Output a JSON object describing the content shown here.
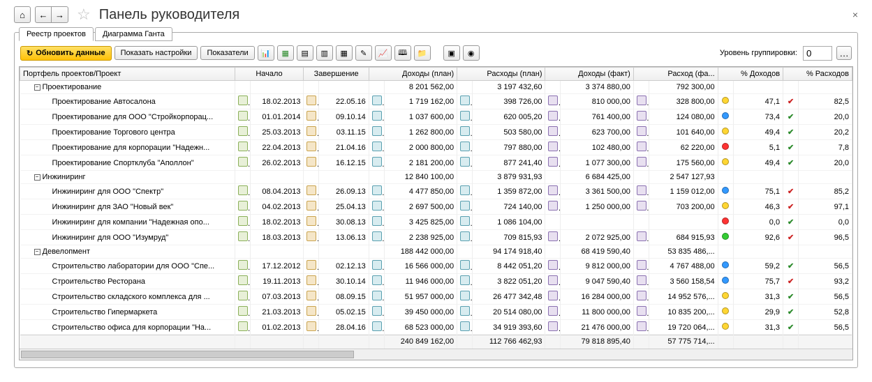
{
  "header": {
    "title": "Панель руководителя"
  },
  "tabs": [
    {
      "label": "Реестр проектов",
      "active": true
    },
    {
      "label": "Диаграмма Ганта",
      "active": false
    }
  ],
  "toolbar": {
    "refresh": "Обновить данные",
    "show_settings": "Показать настройки",
    "indicators": "Показатели",
    "grouping_label": "Уровень группировки:",
    "grouping_value": "0"
  },
  "columns": [
    "Портфель проектов/Проект",
    "Начало",
    "Завершение",
    "Доходы (план)",
    "Расходы (план)",
    "Доходы (факт)",
    "Расход (фа...",
    "% Доходов",
    "% Расходов"
  ],
  "groups": [
    {
      "name": "Проектирование",
      "sums": {
        "dp": "8 201 562,00",
        "rp": "3 197 432,60",
        "df": "3 374 880,00",
        "rf": "792 300,00"
      },
      "rows": [
        {
          "name": "Проектирование Автосалона",
          "start": "18.02.2013",
          "end": "22.05.16",
          "dp": "1 719 162,00",
          "rp": "398 726,00",
          "df": "810 000,00",
          "rf": "328 800,00",
          "pd": "47,1",
          "pr": "82,5",
          "d1": "y",
          "chk": "r"
        },
        {
          "name": "Проектирование для ООО \"Стройкорпорац...",
          "start": "01.01.2014",
          "end": "09.10.14",
          "dp": "1 037 600,00",
          "rp": "620 005,20",
          "df": "761 400,00",
          "rf": "124 080,00",
          "pd": "73,4",
          "pr": "20,0",
          "d1": "b",
          "chk": "g"
        },
        {
          "name": "Проектирование Торгового центра",
          "start": "25.03.2013",
          "end": "03.11.15",
          "dp": "1 262 800,00",
          "rp": "503 580,00",
          "df": "623 700,00",
          "rf": "101 640,00",
          "pd": "49,4",
          "pr": "20,2",
          "d1": "y",
          "chk": "g"
        },
        {
          "name": "Проектирование для корпорации \"Надежн...",
          "start": "22.04.2013",
          "end": "21.04.16",
          "dp": "2 000 800,00",
          "rp": "797 880,00",
          "df": "102 480,00",
          "rf": "62 220,00",
          "pd": "5,1",
          "pr": "7,8",
          "d1": "r",
          "chk": "g"
        },
        {
          "name": "Проектирование Спортклуба \"Аполлон\"",
          "start": "26.02.2013",
          "end": "16.12.15",
          "dp": "2 181 200,00",
          "rp": "877 241,40",
          "df": "1 077 300,00",
          "rf": "175 560,00",
          "pd": "49,4",
          "pr": "20,0",
          "d1": "y",
          "chk": "g"
        }
      ]
    },
    {
      "name": "Инжиниринг",
      "sums": {
        "dp": "12 840 100,00",
        "rp": "3 879 931,93",
        "df": "6 684 425,00",
        "rf": "2 547 127,93"
      },
      "rows": [
        {
          "name": "Инжиниринг для ООО \"Спектр\"",
          "start": "08.04.2013",
          "end": "26.09.13",
          "dp": "4 477 850,00",
          "rp": "1 359 872,00",
          "df": "3 361 500,00",
          "rf": "1 159 012,00",
          "pd": "75,1",
          "pr": "85,2",
          "d1": "b",
          "chk": "r"
        },
        {
          "name": "Инжиниринг для ЗАО \"Новый век\"",
          "start": "04.02.2013",
          "end": "25.04.13",
          "dp": "2 697 500,00",
          "rp": "724 140,00",
          "df": "1 250 000,00",
          "rf": "703 200,00",
          "pd": "46,3",
          "pr": "97,1",
          "d1": "y",
          "chk": "r"
        },
        {
          "name": "Инжиниринг для компании \"Надежная опо...",
          "start": "18.02.2013",
          "end": "30.08.13",
          "dp": "3 425 825,00",
          "rp": "1 086 104,00",
          "df": "",
          "rf": "",
          "pd": "0,0",
          "pr": "0,0",
          "d1": "r",
          "chk": "g"
        },
        {
          "name": "Инжиниринг для ООО \"Изумруд\"",
          "start": "18.03.2013",
          "end": "13.06.13",
          "dp": "2 238 925,00",
          "rp": "709 815,93",
          "df": "2 072 925,00",
          "rf": "684 915,93",
          "pd": "92,6",
          "pr": "96,5",
          "d1": "g",
          "chk": "r"
        }
      ]
    },
    {
      "name": "Девелопмент",
      "sums": {
        "dp": "188 442 000,00",
        "rp": "94 174 918,40",
        "df": "68 419 590,40",
        "rf": "53 835 486,..."
      },
      "rows": [
        {
          "name": "Строительство лаборатории для ООО \"Спе...",
          "start": "17.12.2012",
          "end": "02.12.13",
          "dp": "16 566 000,00",
          "rp": "8 442 051,20",
          "df": "9 812 000,00",
          "rf": "4 767 488,00",
          "pd": "59,2",
          "pr": "56,5",
          "d1": "b",
          "chk": "g"
        },
        {
          "name": "Строительство Ресторана",
          "start": "19.11.2013",
          "end": "30.10.14",
          "dp": "11 946 000,00",
          "rp": "3 822 051,20",
          "df": "9 047 590,40",
          "rf": "3 560 158,54",
          "pd": "75,7",
          "pr": "93,2",
          "d1": "b",
          "chk": "r"
        },
        {
          "name": "Строительство складского комплекса для ...",
          "start": "07.03.2013",
          "end": "08.09.15",
          "dp": "51 957 000,00",
          "rp": "26 477 342,48",
          "df": "16 284 000,00",
          "rf": "14 952 576,...",
          "pd": "31,3",
          "pr": "56,5",
          "d1": "y",
          "chk": "g"
        },
        {
          "name": "Строительство Гипермаркета",
          "start": "21.03.2013",
          "end": "05.02.15",
          "dp": "39 450 000,00",
          "rp": "20 514 080,00",
          "df": "11 800 000,00",
          "rf": "10 835 200,...",
          "pd": "29,9",
          "pr": "52,8",
          "d1": "y",
          "chk": "g"
        },
        {
          "name": "Строительство офиса для корпорации \"На...",
          "start": "01.02.2013",
          "end": "28.04.16",
          "dp": "68 523 000,00",
          "rp": "34 919 393,60",
          "df": "21 476 000,00",
          "rf": "19 720 064,...",
          "pd": "31,3",
          "pr": "56,5",
          "d1": "y",
          "chk": "g"
        }
      ]
    }
  ],
  "totals": {
    "dp": "240 849 162,00",
    "rp": "112 766 462,93",
    "df": "79 818 895,40",
    "rf": "57 775 714,..."
  }
}
